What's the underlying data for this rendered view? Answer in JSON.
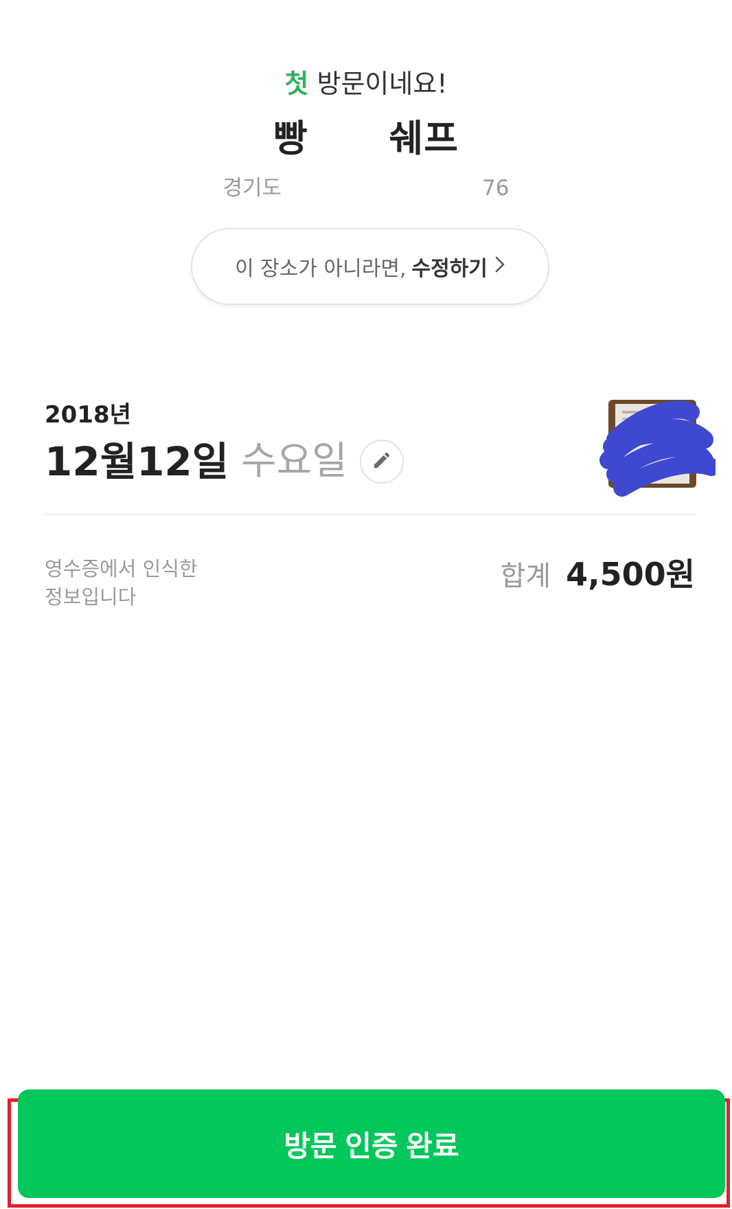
{
  "header": {
    "greeting_accent": "첫",
    "greeting_rest": " 방문이네요!",
    "place_name_start": "빵",
    "place_name_end": "쉐프",
    "address_start": "경기도",
    "address_end": "76"
  },
  "edit_place": {
    "prefix": "이 장소가 아니라면,",
    "action": "수정하기",
    "chevron_icon": "chevron-right-icon"
  },
  "visit": {
    "year": "2018년",
    "date": "12월12일",
    "weekday": "수요일",
    "edit_icon": "pencil-icon"
  },
  "receipt": {
    "note_line1": "영수증에서 인식한",
    "note_line2": "정보입니다",
    "total_label": "합계",
    "total_value": "4,500원"
  },
  "footer": {
    "confirm_label": "방문 인증 완료"
  },
  "colors": {
    "accent_green": "#2db35a",
    "button_green": "#03c75a",
    "highlight_red": "#e0202b",
    "scribble_blue": "#3e48d0"
  }
}
